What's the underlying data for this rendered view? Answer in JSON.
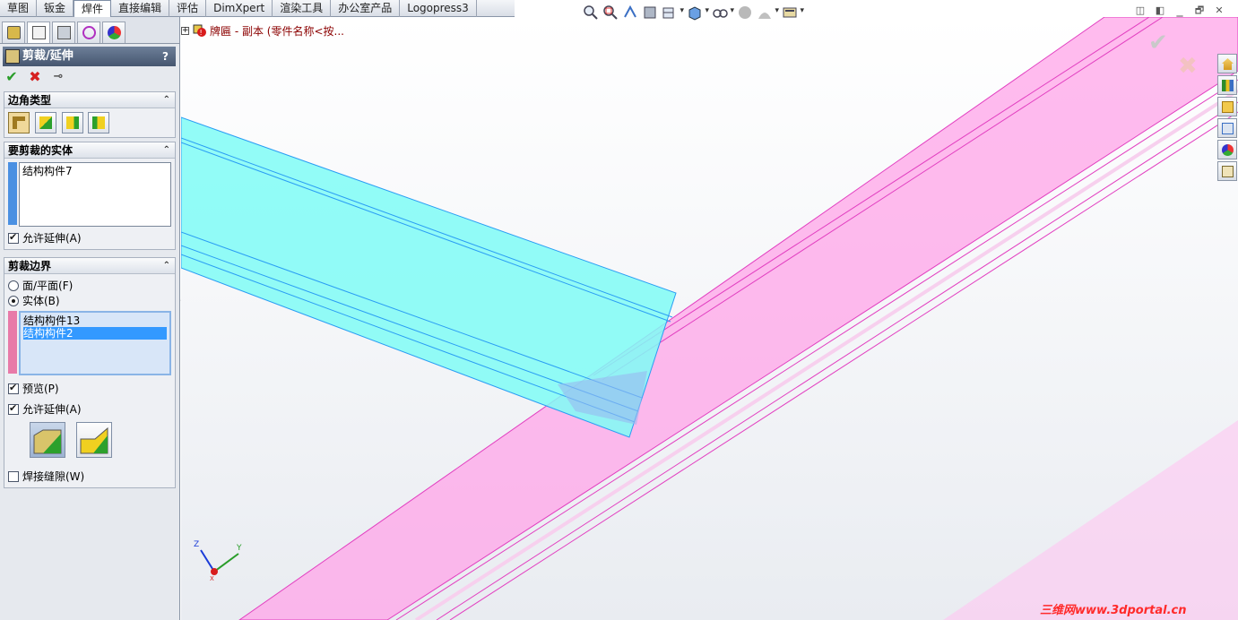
{
  "command_tabs": [
    "草图",
    "钣金",
    "焊件",
    "直接编辑",
    "评估",
    "DimXpert",
    "渲染工具",
    "办公室产品",
    "Logopress3"
  ],
  "active_tab_index": 2,
  "feature_manager_tabs": [
    "featuremanager-icon",
    "propertymanager-icon",
    "configurationmanager-icon",
    "dimxpert-icon",
    "display-manager-icon"
  ],
  "property_manager": {
    "title": "剪裁/延伸",
    "help": "?",
    "ok": "✔",
    "cancel": "✖",
    "pin": "⊸",
    "corner_type": {
      "label": "边角类型",
      "buttons": [
        "end-trim-icon",
        "end-miter-icon",
        "end-butt1-icon",
        "end-butt2-icon"
      ],
      "selected": 0
    },
    "bodies_to_trim": {
      "label": "要剪裁的实体",
      "items": [
        "结构构件7"
      ],
      "bar_color": "#4a90e2",
      "allow_extension_label": "允许延伸(A)",
      "allow_extension": true
    },
    "trimming_boundary": {
      "label": "剪裁边界",
      "options": [
        "面/平面(F)",
        "实体(B)"
      ],
      "selected_option": 1,
      "items": [
        "结构构件13",
        "结构构件2"
      ],
      "selected_item": 1,
      "bar_color": "#e87aa8",
      "preview_label": "预览(P)",
      "preview": true,
      "allow_extension_label": "允许延伸(A)",
      "allow_extension": true,
      "weld_gap_label": "焊接缝隙(W)",
      "weld_gap": false
    }
  },
  "tree_node_label": "牌匾 - 副本  (零件名称<按...",
  "hud_icons": [
    "zoom-to-fit-icon",
    "zoom-to-area-icon",
    "previous-view-icon",
    "section-view-icon",
    "view-orientation-icon",
    "display-style-icon",
    "hide-show-items-icon",
    "edit-appearance-icon",
    "apply-scene-icon",
    "view-settings-icon"
  ],
  "window_controls": [
    "◫",
    "◧",
    "🗕",
    "🗗",
    "✕"
  ],
  "confirm_ok": "✔",
  "confirm_cancel": "✖",
  "task_pane_icons": [
    "home-icon",
    "design-library-icon",
    "file-explorer-icon",
    "view-palette-icon",
    "appearances-icon",
    "custom-properties-icon"
  ],
  "triad": {
    "x": "X",
    "y": "Y",
    "z": "Z"
  },
  "watermark": "三维网www.3dportal.cn",
  "colors": {
    "cyan_body": "#7ffcf6",
    "pink_body": "#ff9fe6",
    "accent": "#3399ff"
  }
}
